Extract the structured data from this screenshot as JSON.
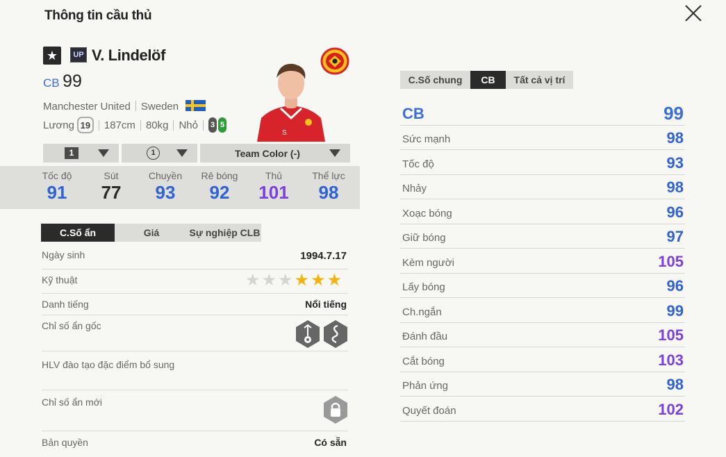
{
  "header": {
    "title": "Thông tin cầu thủ"
  },
  "player": {
    "name": "V. Lindelöf",
    "position": "CB",
    "ovr": "99",
    "club": "Manchester United",
    "nation": "Sweden",
    "salary_label": "Lương",
    "salary": "19",
    "height": "187cm",
    "weight": "80kg",
    "body": "Nhỏ",
    "foot_left": "3",
    "foot_right": "5"
  },
  "dropdowns": {
    "upgrade": "1",
    "level": "1",
    "team_color": "Team Color (-)"
  },
  "main_stats": [
    {
      "label": "Tốc độ",
      "value": "91",
      "color": "#2f62d4"
    },
    {
      "label": "Sút",
      "value": "77",
      "color": "#2a2a2a"
    },
    {
      "label": "Chuyền",
      "value": "93",
      "color": "#2f62d4"
    },
    {
      "label": "Rê bóng",
      "value": "92",
      "color": "#2f62d4"
    },
    {
      "label": "Thủ",
      "value": "101",
      "color": "#7b3fe0"
    },
    {
      "label": "Thể lực",
      "value": "98",
      "color": "#2f62d4"
    }
  ],
  "left_tabs": [
    {
      "label": "C.Số ẩn",
      "active": true
    },
    {
      "label": "Giá",
      "active": false
    },
    {
      "label": "Sự nghiệp CLB",
      "active": false
    }
  ],
  "info_rows": {
    "birth_label": "Ngày sinh",
    "birth_value": "1994.7.17",
    "skill_label": "Kỹ thuật",
    "skill_stars": 3,
    "skill_max": 6,
    "fame_label": "Danh tiếng",
    "fame_value": "Nổi tiếng",
    "traits_label": "Chỉ số ẩn gốc",
    "trainer_label": "HLV đào tạo đặc điểm bổ sung",
    "new_traits_label": "Chỉ số ẩn mới",
    "license_label": "Bản quyền",
    "license_value": "Có sẵn"
  },
  "right_tabs": [
    {
      "label": "C.Số chung",
      "active": false
    },
    {
      "label": "CB",
      "active": true
    },
    {
      "label": "Tất cả vị trí",
      "active": false
    }
  ],
  "position_stats": {
    "header_label": "CB",
    "header_value": "99",
    "rows": [
      {
        "label": "Sức mạnh",
        "value": "98",
        "color": "#2f62d4"
      },
      {
        "label": "Tốc độ",
        "value": "93",
        "color": "#2f62d4"
      },
      {
        "label": "Nhảy",
        "value": "98",
        "color": "#2f62d4"
      },
      {
        "label": "Xoạc bóng",
        "value": "96",
        "color": "#2f62d4"
      },
      {
        "label": "Giữ bóng",
        "value": "97",
        "color": "#2f62d4"
      },
      {
        "label": "Kèm người",
        "value": "105",
        "color": "#7b3fe0"
      },
      {
        "label": "Lấy bóng",
        "value": "96",
        "color": "#2f62d4"
      },
      {
        "label": "Ch.ngắn",
        "value": "99",
        "color": "#2f62d4"
      },
      {
        "label": "Đánh đầu",
        "value": "105",
        "color": "#7b3fe0"
      },
      {
        "label": "Cắt bóng",
        "value": "103",
        "color": "#7b3fe0"
      },
      {
        "label": "Phản ứng",
        "value": "98",
        "color": "#2f62d4"
      },
      {
        "label": "Quyết đoán",
        "value": "102",
        "color": "#7b3fe0"
      }
    ]
  },
  "icons": {
    "close": "close-icon",
    "card": "star-icon",
    "upgrade": "up-badge-icon",
    "club": "manchester-united-crest-icon",
    "flag": "sweden-flag-icon",
    "trait1": "hidden-trait-icon",
    "trait2": "hidden-trait-snake-icon",
    "lock": "lock-icon"
  }
}
